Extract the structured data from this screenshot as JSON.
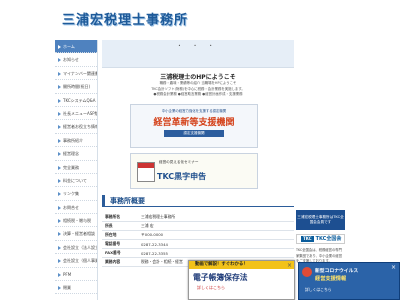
{
  "site": {
    "logo": "三浦宏税理士事務所"
  },
  "nav": [
    "ホーム",
    "お知らせ",
    "マイナンバー関連書式",
    "開所時間(祝日)",
    "TKCシステムQ&A",
    "社長メニューASP版",
    "経営者お役立ち情報",
    "事務所紹介",
    "経営理念",
    "完全業務",
    "料金について",
    "リンク集",
    "お問合せ",
    "相続税・贈与税",
    "決算・経営者相談",
    "会社設立（法人設立）",
    "会社設立（個人事業）",
    "PFM",
    "閉業"
  ],
  "main": {
    "dots": "•  •  •",
    "welcome": "三浦税理士のHPにようこそ",
    "intro1": "職務・趣味・業績等の紹介 当職場をHPにようこそ",
    "intro2": "TKC会計ソフト(財務)を中心に税務・会計業務を実施します。",
    "intro3": "●税務会計業務 ●経営助言業務 ●経営計画作成・支援業務"
  },
  "banner1": {
    "sub": "中小企業の経営力強化を支援する認定機関",
    "title": "経営革新等支援機関",
    "cap": "認定支援機関"
  },
  "banner2": {
    "sub": "経営の見える化セミナー",
    "title": "TKC黒字申告"
  },
  "office_section": {
    "heading": "事務所概要"
  },
  "office": [
    {
      "k": "事務所名",
      "v": "三浦宏税理士事務所"
    },
    {
      "k": "所長",
      "v": "三浦 宏"
    },
    {
      "k": "所在地",
      "v": "〒000-0000"
    },
    {
      "k": "電話番号",
      "v": "0287-22-3344"
    },
    {
      "k": "FAX番号",
      "v": "0287-22-3355"
    },
    {
      "k": "業務内容",
      "v": "税務・会計・相続・経営"
    }
  ],
  "side": {
    "banner1": "三浦宏税理士事務所はTKC全国会会員です",
    "tkc": "TKC全国会",
    "tkc_logo": "TKC",
    "text": "TKC全国会は、税務経営の専門家集団であり、中小企業の経営をご支援しております。"
  },
  "popup1": {
    "ribbon": "動画で解説！すぐわかる！",
    "title": "電子帳簿保存法",
    "url": "詳しくはこちら",
    "close": "×"
  },
  "popup2": {
    "head": "新型コロナウイルス",
    "title": "経営支援情報",
    "link": "詳しくはこちら",
    "close": "×"
  },
  "colors": {
    "brand": "#1e5a99",
    "accent": "#d44119",
    "nav_active": "#4f82bf"
  }
}
